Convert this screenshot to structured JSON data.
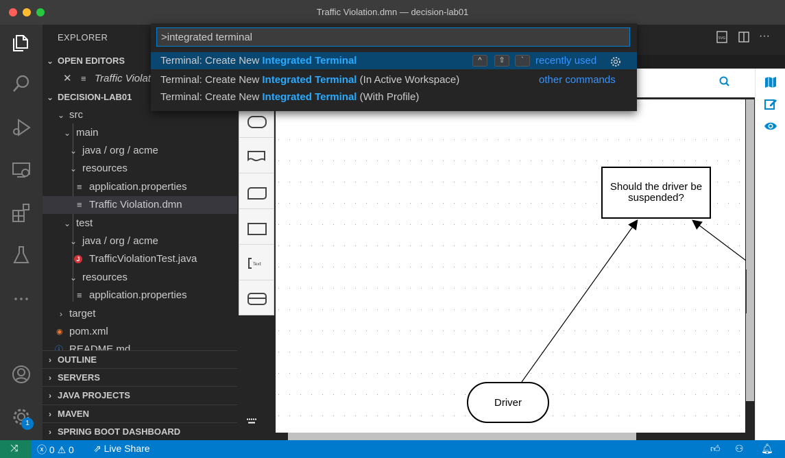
{
  "window": {
    "title": "Traffic Violation.dmn — decision-lab01"
  },
  "sidebar": {
    "title": "EXPLORER",
    "open_editors": {
      "label": "OPEN EDITORS",
      "file": "Traffic Violation.dmn"
    },
    "project": {
      "label": "DECISION-LAB01",
      "tree": [
        {
          "label": "src"
        },
        {
          "label": "main"
        },
        {
          "label": "java / org / acme"
        },
        {
          "label": "resources"
        },
        {
          "label": "application.properties"
        },
        {
          "label": "Traffic Violation.dmn"
        },
        {
          "label": "test"
        },
        {
          "label": "java / org / acme"
        },
        {
          "label": "TrafficViolationTest.java"
        },
        {
          "label": "resources"
        },
        {
          "label": "application.properties"
        },
        {
          "label": "target"
        },
        {
          "label": "pom.xml"
        },
        {
          "label": "README.md"
        }
      ]
    },
    "sections": [
      "OUTLINE",
      "SERVERS",
      "JAVA PROJECTS",
      "MAVEN",
      "SPRING BOOT DASHBOARD"
    ]
  },
  "activity_bar": {
    "icons": [
      "explorer-icon",
      "search-icon",
      "run-debug-icon",
      "remote-explorer-icon",
      "extensions-icon",
      "testing-icon",
      "more-icon",
      "accounts-icon",
      "manage-gear-icon"
    ],
    "manage_badge": "1"
  },
  "command_palette": {
    "input_value": ">integrated terminal",
    "items": [
      {
        "prefix": "Terminal: Create New ",
        "match": "Integrated Terminal",
        "suffix": "",
        "meta": "recently used"
      },
      {
        "prefix": "Terminal: Create New ",
        "match": "Integrated Terminal",
        "suffix": " (In Active Workspace)",
        "meta": "other commands"
      },
      {
        "prefix": "Terminal: Create New ",
        "match": "Integrated Terminal",
        "suffix": " (With Profile)",
        "meta": ""
      }
    ],
    "keybinding": [
      "^",
      "⇧",
      "`"
    ]
  },
  "dmn": {
    "decision_label": "Should the driver be suspended?",
    "input_label": "Driver"
  },
  "statusbar": {
    "errors": "0",
    "warnings": "0",
    "live_share": "Live Share"
  },
  "colors": {
    "accent": "#007acc",
    "highlight": "#2aaaff",
    "remote": "#16825d"
  }
}
